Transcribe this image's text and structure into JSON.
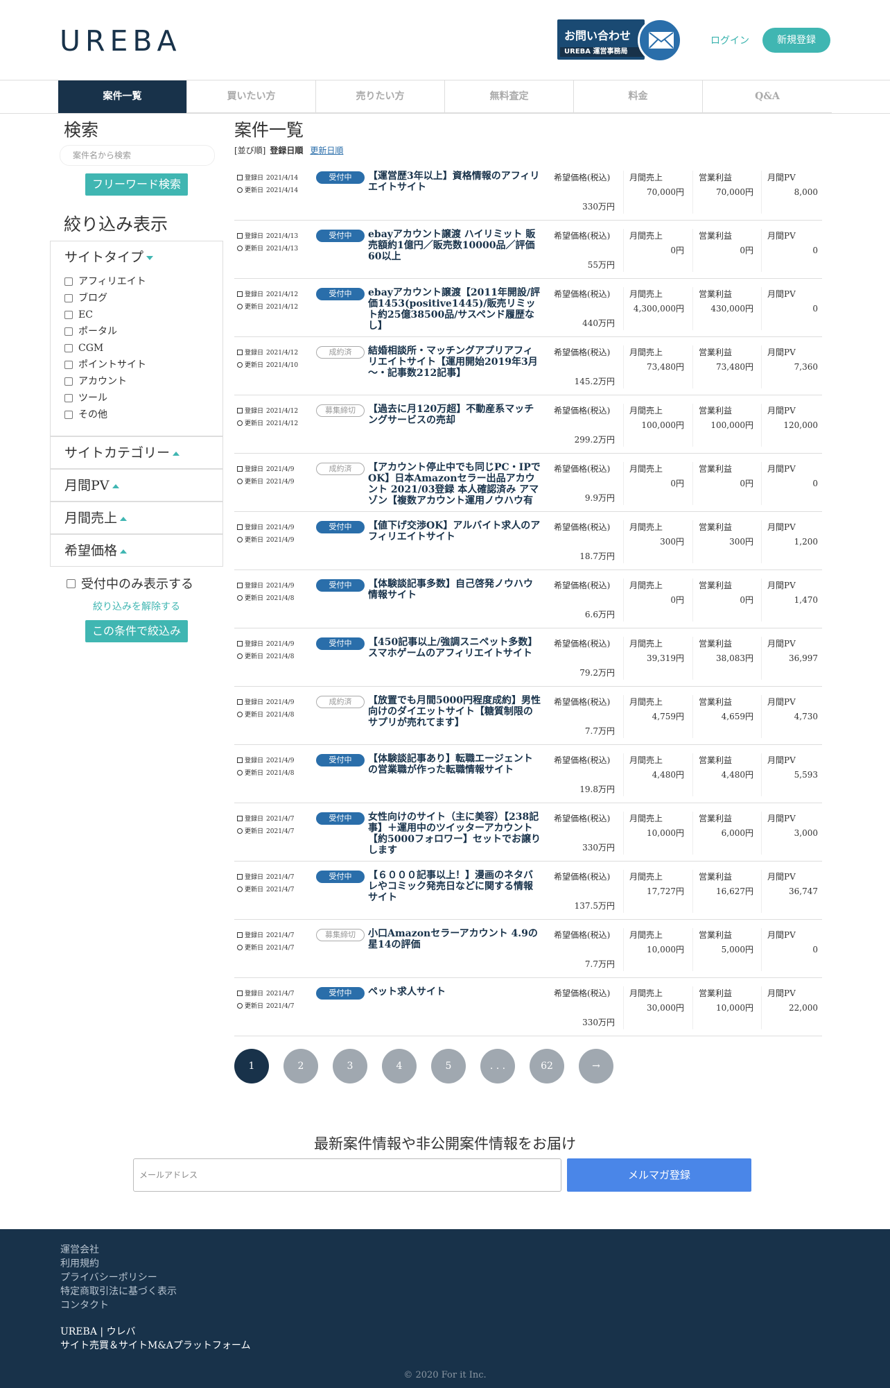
{
  "header": {
    "logo": "UREBA",
    "contact_label": "お問い合わせ",
    "contact_sub": "UREBA 運営事務局",
    "login": "ログイン",
    "signup": "新規登録"
  },
  "nav": [
    "案件一覧",
    "買いたい方",
    "売りたい方",
    "無料査定",
    "料金",
    "Q&A"
  ],
  "sidebar": {
    "search_heading": "検索",
    "search_placeholder": "案件名から検索",
    "freeword_button": "フリーワード検索",
    "filter_heading": "絞り込み表示",
    "site_type": "サイトタイプ",
    "site_types": [
      "アフィリエイト",
      "ブログ",
      "EC",
      "ポータル",
      "CGM",
      "ポイントサイト",
      "アカウント",
      "ツール",
      "その他"
    ],
    "site_category": "サイトカテゴリー",
    "monthly_pv": "月間PV",
    "monthly_sales": "月間売上",
    "desired_price": "希望価格",
    "only_open": "受付中のみ表示する",
    "reset": "絞り込みを解除する",
    "apply": "この条件で絞込み"
  },
  "main": {
    "heading": "案件一覧",
    "sort_label": "[並び順]",
    "sort_current": "登録日順",
    "sort_alt": "更新日順",
    "labels": {
      "registered": "登録日",
      "updated": "更新日",
      "price": "希望価格(税込)",
      "sales": "月間売上",
      "profit": "営業利益",
      "pv": "月間PV"
    }
  },
  "listings": [
    {
      "reg": "2021/4/14",
      "upd": "2021/4/14",
      "status": "受付中",
      "open": true,
      "title": "【運営歴3年以上】資格情報のアフィリエイトサイト",
      "price": "330万円",
      "sales": "70,000円",
      "profit": "70,000円",
      "pv": "8,000"
    },
    {
      "reg": "2021/4/13",
      "upd": "2021/4/13",
      "status": "受付中",
      "open": true,
      "title": "ebayアカウント譲渡 ハイリミット 販売額約1億円／販売数10000品／評価60以上",
      "price": "55万円",
      "sales": "0円",
      "profit": "0円",
      "pv": "0"
    },
    {
      "reg": "2021/4/12",
      "upd": "2021/4/12",
      "status": "受付中",
      "open": true,
      "title": "ebayアカウント譲渡【2011年開設/評価1453(positive1445)/販売リミット約25億38500品/サスペンド履歴なし】",
      "price": "440万円",
      "sales": "4,300,000円",
      "profit": "430,000円",
      "pv": "0"
    },
    {
      "reg": "2021/4/12",
      "upd": "2021/4/10",
      "status": "成約済",
      "open": false,
      "title": "結婚相談所・マッチングアプリアフィリエイトサイト【運用開始2019年3月～・記事数212記事】",
      "price": "145.2万円",
      "sales": "73,480円",
      "profit": "73,480円",
      "pv": "7,360"
    },
    {
      "reg": "2021/4/12",
      "upd": "2021/4/12",
      "status": "募集締切",
      "open": false,
      "title": "【過去に月120万超】不動産系マッチングサービスの売却",
      "price": "299.2万円",
      "sales": "100,000円",
      "profit": "100,000円",
      "pv": "120,000"
    },
    {
      "reg": "2021/4/9",
      "upd": "2021/4/9",
      "status": "成約済",
      "open": false,
      "title": "【アカウント停止中でも同じPC・IPでOK】日本Amazonセラー出品アカウント 2021/03登録 本人確認済み アマゾン【複数アカウント運用ノウハウ有り…",
      "price": "9.9万円",
      "sales": "0円",
      "profit": "0円",
      "pv": "0"
    },
    {
      "reg": "2021/4/9",
      "upd": "2021/4/9",
      "status": "受付中",
      "open": true,
      "title": "【値下げ交渉OK】アルバイト求人のアフィリエイトサイト",
      "price": "18.7万円",
      "sales": "300円",
      "profit": "300円",
      "pv": "1,200"
    },
    {
      "reg": "2021/4/9",
      "upd": "2021/4/8",
      "status": "受付中",
      "open": true,
      "title": "【体験談記事多数】自己啓発ノウハウ情報サイト",
      "price": "6.6万円",
      "sales": "0円",
      "profit": "0円",
      "pv": "1,470"
    },
    {
      "reg": "2021/4/9",
      "upd": "2021/4/8",
      "status": "受付中",
      "open": true,
      "title": "【450記事以上/強調スニペット多数】スマホゲームのアフィリエイトサイト",
      "price": "79.2万円",
      "sales": "39,319円",
      "profit": "38,083円",
      "pv": "36,997"
    },
    {
      "reg": "2021/4/9",
      "upd": "2021/4/8",
      "status": "成約済",
      "open": false,
      "title": "【放置でも月間5000円程度成約】男性向けのダイエットサイト【糖質制限のサプリが売れてます】",
      "price": "7.7万円",
      "sales": "4,759円",
      "profit": "4,659円",
      "pv": "4,730"
    },
    {
      "reg": "2021/4/9",
      "upd": "2021/4/8",
      "status": "受付中",
      "open": true,
      "title": "【体験談記事あり】転職エージェントの営業職が作った転職情報サイト",
      "price": "19.8万円",
      "sales": "4,480円",
      "profit": "4,480円",
      "pv": "5,593"
    },
    {
      "reg": "2021/4/7",
      "upd": "2021/4/7",
      "status": "受付中",
      "open": true,
      "title": "女性向けのサイト（主に美容）【238記事】＋運用中のツイッターアカウント【約5000フォロワー】セットでお譲りします",
      "price": "330万円",
      "sales": "10,000円",
      "profit": "6,000円",
      "pv": "3,000"
    },
    {
      "reg": "2021/4/7",
      "upd": "2021/4/7",
      "status": "受付中",
      "open": true,
      "title": "【６０００記事以上！】漫画のネタバレやコミック発売日などに関する情報サイト",
      "price": "137.5万円",
      "sales": "17,727円",
      "profit": "16,627円",
      "pv": "36,747"
    },
    {
      "reg": "2021/4/7",
      "upd": "2021/4/7",
      "status": "募集締切",
      "open": false,
      "title": "小口Amazonセラーアカウント 4.9の星14の評価",
      "price": "7.7万円",
      "sales": "10,000円",
      "profit": "5,000円",
      "pv": "0"
    },
    {
      "reg": "2021/4/7",
      "upd": "2021/4/7",
      "status": "受付中",
      "open": true,
      "title": "ペット求人サイト",
      "price": "330万円",
      "sales": "30,000円",
      "profit": "10,000円",
      "pv": "22,000"
    }
  ],
  "pager": [
    "1",
    "2",
    "3",
    "4",
    "5",
    ". . .",
    "62",
    "→"
  ],
  "newsletter": {
    "heading": "最新案件情報や非公開案件情報をお届け",
    "placeholder": "メールアドレス",
    "button": "メルマガ登録"
  },
  "footer": {
    "links": [
      "運営会社",
      "利用規約",
      "プライバシーポリシー",
      "特定商取引法に基づく表示",
      "コンタクト"
    ],
    "brand": "UREBA | ウレバ",
    "tagline": "サイト売買＆サイトM&Aプラットフォーム",
    "copyright": "© 2020 For it Inc."
  },
  "colors": {
    "navy": "#18324a",
    "teal": "#40b6b2",
    "blue": "#2a6eaa",
    "button_blue": "#4a86e8"
  }
}
